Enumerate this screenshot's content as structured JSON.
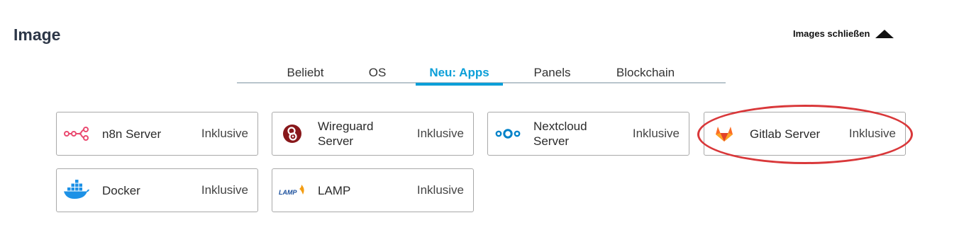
{
  "section": {
    "title": "Image",
    "collapse_label": "Images schließen"
  },
  "tabs": [
    {
      "label": "Beliebt",
      "active": false
    },
    {
      "label": "OS",
      "active": false
    },
    {
      "label": "Neu: Apps",
      "active": true
    },
    {
      "label": "Panels",
      "active": false
    },
    {
      "label": "Blockchain",
      "active": false
    }
  ],
  "images": [
    {
      "name": "n8n Server",
      "badge": "Inklusive",
      "icon": "n8n-icon"
    },
    {
      "name": "Wireguard Server",
      "badge": "Inklusive",
      "icon": "wireguard-icon"
    },
    {
      "name": "Nextcloud Server",
      "badge": "Inklusive",
      "icon": "nextcloud-icon"
    },
    {
      "name": "Gitlab Server",
      "badge": "Inklusive",
      "icon": "gitlab-icon",
      "highlighted": true
    },
    {
      "name": "Docker",
      "badge": "Inklusive",
      "icon": "docker-icon"
    },
    {
      "name": "LAMP",
      "badge": "Inklusive",
      "icon": "lamp-icon",
      "icon_text": "LAMP"
    }
  ],
  "colors": {
    "accent": "#0b9fd8",
    "highlight": "#d9383a",
    "n8n": "#ea4b71",
    "wireguard": "#88171a",
    "nextcloud": "#0082c9",
    "gitlab": "#fc6d26",
    "docker": "#1d91e6"
  }
}
